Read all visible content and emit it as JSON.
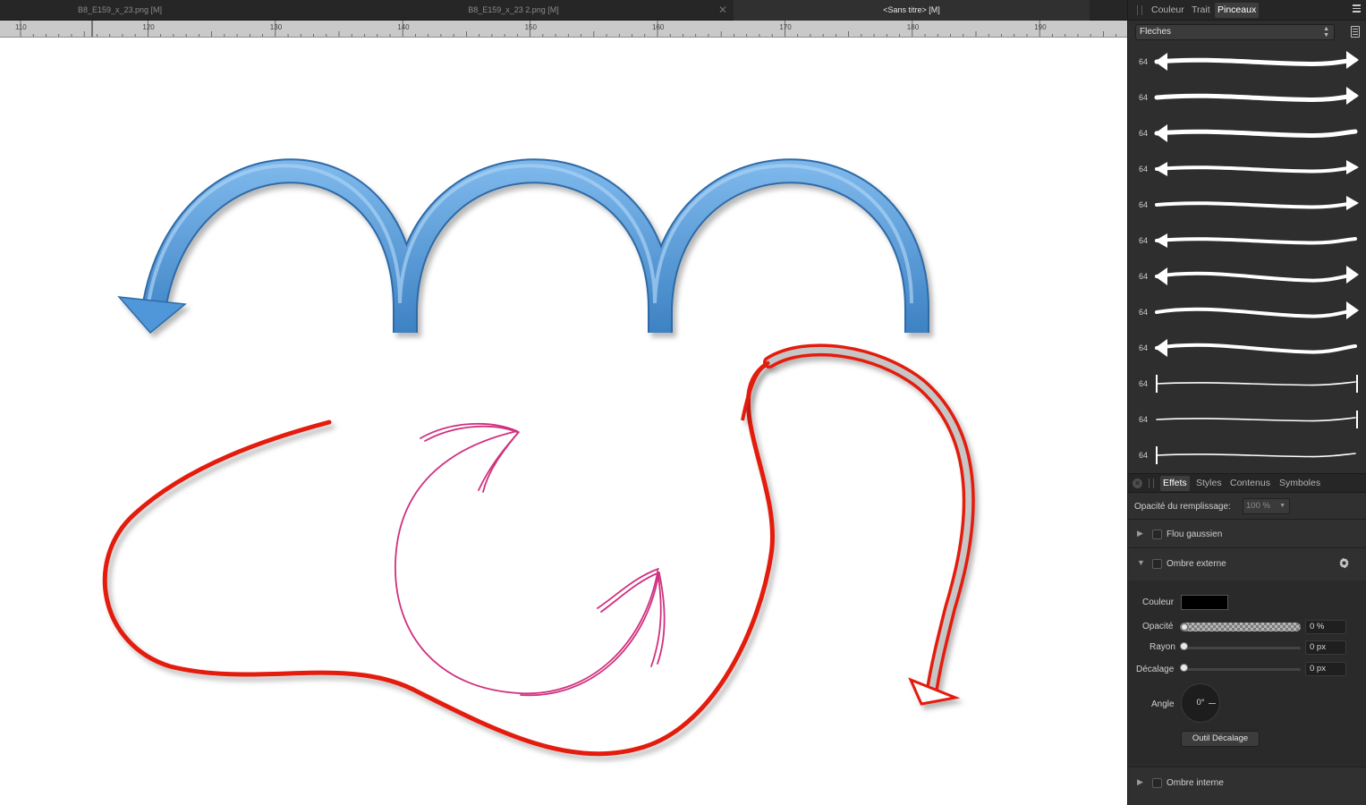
{
  "document_tabs": [
    {
      "label": "B8_E159_x_23.png [M]",
      "active": false
    },
    {
      "label": "B8_E159_x_23 2.png [M]",
      "active": false
    },
    {
      "label": "<Sans titre> [M]",
      "active": true
    }
  ],
  "ruler": {
    "labels": [
      "110",
      "120",
      "130",
      "140",
      "150",
      "160",
      "170",
      "180",
      "190"
    ]
  },
  "panel": {
    "tabs": [
      {
        "label": "Couleur",
        "active": false
      },
      {
        "label": "Trait",
        "active": false
      },
      {
        "label": "Pinceaux",
        "active": true
      }
    ],
    "menu_icon": "menu-lines-icon",
    "brush_category": "Fleches",
    "brushes": [
      {
        "size": "64",
        "style": "double-arrow-thick"
      },
      {
        "size": "64",
        "style": "arrow-right-thick"
      },
      {
        "size": "64",
        "style": "arrow-left-thick"
      },
      {
        "size": "64",
        "style": "double-arrow-tapered"
      },
      {
        "size": "64",
        "style": "arrow-right-tapered"
      },
      {
        "size": "64",
        "style": "arrow-left-tapered"
      },
      {
        "size": "64",
        "style": "double-arrow-wave"
      },
      {
        "size": "64",
        "style": "arrow-right-wave"
      },
      {
        "size": "64",
        "style": "arrow-left-wave"
      },
      {
        "size": "64",
        "style": "bar-ends"
      },
      {
        "size": "64",
        "style": "bar-right"
      },
      {
        "size": "64",
        "style": "bar-left"
      }
    ]
  },
  "effects": {
    "tabs": [
      {
        "label": "Effets",
        "active": true
      },
      {
        "label": "Styles",
        "active": false
      },
      {
        "label": "Contenus",
        "active": false
      },
      {
        "label": "Symboles",
        "active": false
      }
    ],
    "fill_opacity_label": "Opacité du remplissage:",
    "fill_opacity_value": "100 %",
    "gaussian_blur_label": "Flou gaussien",
    "outer_shadow_label": "Ombre externe",
    "inner_shadow_label": "Ombre interne",
    "shadow": {
      "color_label": "Couleur",
      "color": "#000000",
      "opacity_label": "Opacité",
      "opacity_value": "0 %",
      "radius_label": "Rayon",
      "radius_value": "0 px",
      "offset_label": "Décalage",
      "offset_value": "0 px",
      "angle_label": "Angle",
      "angle_value": "0°",
      "offset_tool_label": "Outil Décalage"
    }
  },
  "colors": {
    "blue_arrow": "#4f97d8",
    "red_arrow": "#e31b0f",
    "magenta_arrow": "#d0307f",
    "panel_bg": "#2e2e2e"
  }
}
